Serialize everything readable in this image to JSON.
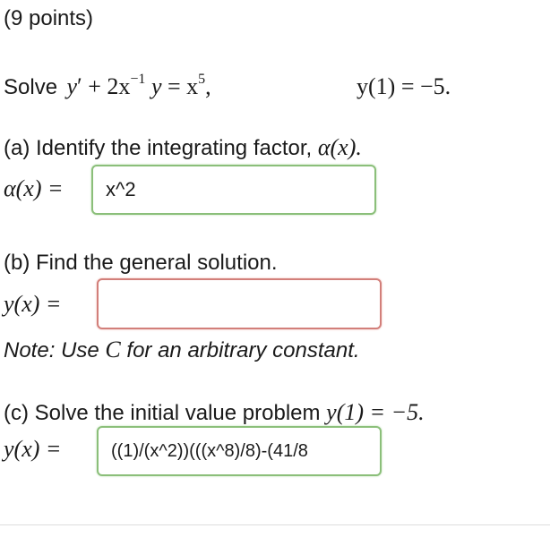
{
  "header": {
    "points": "(9 points)"
  },
  "problem": {
    "prefix": "Solve",
    "eq_y": "y",
    "eq_prime": "′",
    "eq_mid": " + 2x",
    "eq_exp": "−1",
    "eq_y2": " y",
    "eq_eq": " = x",
    "eq_exp5": "5",
    "eq_comma": ",",
    "ic": "y(1) = −5."
  },
  "part_a": {
    "prompt": "(a) Identify the integrating factor, ",
    "prompt_math": "α(x).",
    "label": "α(x) =",
    "value": "x^2"
  },
  "part_b": {
    "prompt": "(b) Find the general solution.",
    "label": "y(x) =",
    "value": "",
    "note_prefix": "Note: Use ",
    "note_c": "C",
    "note_suffix": " for an arbitrary constant."
  },
  "part_c": {
    "prompt": "(c) Solve the initial value problem ",
    "prompt_math": "y(1) = −5.",
    "label": "y(x) =",
    "value": "((1)/(x^2))(((x^8)/8)-(41/8"
  }
}
